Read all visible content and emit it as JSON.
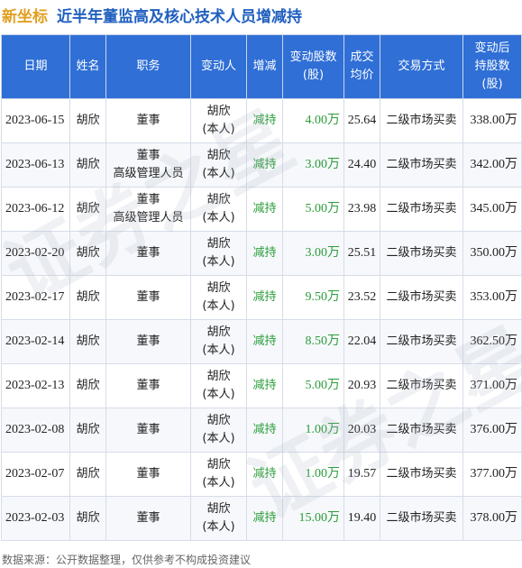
{
  "title": {
    "stock_name": "新坐标",
    "text": "近半年董监高及核心技术人员增减持"
  },
  "table": {
    "headers": [
      "日期",
      "姓名",
      "职务",
      "变动人",
      "增减",
      "变动股数\n(股)",
      "成交\n均价",
      "交易方式",
      "变动后\n持股数\n(股)"
    ],
    "rows": [
      {
        "date": "2023-06-15",
        "name": "胡欣",
        "position": "董事",
        "changer": "胡欣\n(本人)",
        "direction": "减持",
        "amount": "4.00万",
        "price": "25.64",
        "method": "二级市场买卖",
        "after": "338.00万"
      },
      {
        "date": "2023-06-13",
        "name": "胡欣",
        "position": "董事\n高级管理人员",
        "changer": "胡欣\n(本人)",
        "direction": "减持",
        "amount": "3.00万",
        "price": "24.40",
        "method": "二级市场买卖",
        "after": "342.00万"
      },
      {
        "date": "2023-06-12",
        "name": "胡欣",
        "position": "董事\n高级管理人员",
        "changer": "胡欣\n(本人)",
        "direction": "减持",
        "amount": "5.00万",
        "price": "23.98",
        "method": "二级市场买卖",
        "after": "345.00万"
      },
      {
        "date": "2023-02-20",
        "name": "胡欣",
        "position": "董事",
        "changer": "胡欣\n(本人)",
        "direction": "减持",
        "amount": "3.00万",
        "price": "25.51",
        "method": "二级市场买卖",
        "after": "350.00万"
      },
      {
        "date": "2023-02-17",
        "name": "胡欣",
        "position": "董事",
        "changer": "胡欣\n(本人)",
        "direction": "减持",
        "amount": "9.50万",
        "price": "23.52",
        "method": "二级市场买卖",
        "after": "353.00万"
      },
      {
        "date": "2023-02-14",
        "name": "胡欣",
        "position": "董事",
        "changer": "胡欣\n(本人)",
        "direction": "减持",
        "amount": "8.50万",
        "price": "22.04",
        "method": "二级市场买卖",
        "after": "362.50万"
      },
      {
        "date": "2023-02-13",
        "name": "胡欣",
        "position": "董事",
        "changer": "胡欣\n(本人)",
        "direction": "减持",
        "amount": "5.00万",
        "price": "20.93",
        "method": "二级市场买卖",
        "after": "371.00万"
      },
      {
        "date": "2023-02-08",
        "name": "胡欣",
        "position": "董事",
        "changer": "胡欣\n(本人)",
        "direction": "减持",
        "amount": "1.00万",
        "price": "20.03",
        "method": "二级市场买卖",
        "after": "376.00万"
      },
      {
        "date": "2023-02-07",
        "name": "胡欣",
        "position": "董事",
        "changer": "胡欣\n(本人)",
        "direction": "减持",
        "amount": "1.00万",
        "price": "19.57",
        "method": "二级市场买卖",
        "after": "377.00万"
      },
      {
        "date": "2023-02-03",
        "name": "胡欣",
        "position": "董事",
        "changer": "胡欣\n(本人)",
        "direction": "减持",
        "amount": "15.00万",
        "price": "19.40",
        "method": "二级市场买卖",
        "after": "378.00万"
      }
    ]
  },
  "watermark": "证券之星",
  "footer": "数据来源：公开数据整理，仅供参考不构成投资建议",
  "colors": {
    "header_bg": "#2f6fd6",
    "title_blue": "#1f5fbf",
    "stock_orange": "#e0a020",
    "decrease_green": "#2a9d3a"
  }
}
